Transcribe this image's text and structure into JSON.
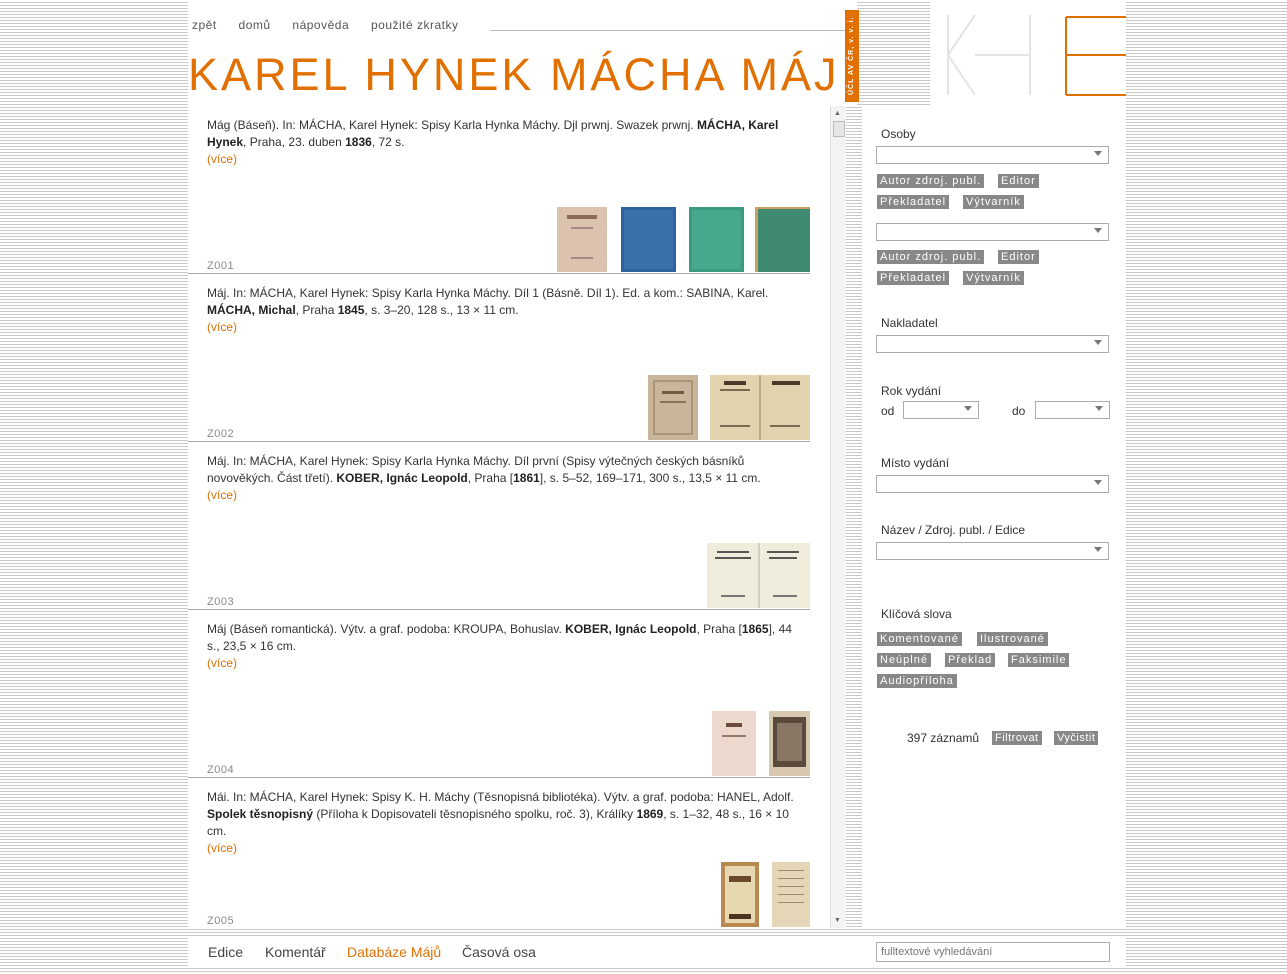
{
  "nav": {
    "items": [
      "zpět",
      "domů",
      "nápověda",
      "použité zkratky"
    ]
  },
  "header": {
    "title": "KAREL HYNEK MÁCHA   MÁJ",
    "badge": "ÚČL AV ČR, v. v. i."
  },
  "logo": {
    "letters": "KHE"
  },
  "records": [
    {
      "pre": "Mág (Báseň). In: MÁCHA, Karel Hynek: Spisy Karla Hynka Máchy. Djl prwnj. Swazek prwnj. ",
      "bold1": "MÁCHA, Karel Hynek",
      "mid1": ", Praha, 23. duben ",
      "year": "1836",
      "post": ", 72 s.",
      "more": "(více)",
      "code": "Z001"
    },
    {
      "pre": "Máj. In: MÁCHA, Karel Hynek: Spisy Karla Hynka Máchy. Díl 1 (Básně. Díl 1). Ed. a kom.: SABINA, Karel. ",
      "bold1": "MÁCHA, Michal",
      "mid1": ", Praha ",
      "year": "1845",
      "post": ", s. 3–20, 128 s., 13 × 11 cm.",
      "more": "(více)",
      "code": "Z002"
    },
    {
      "pre": "Máj. In: MÁCHA, Karel Hynek: Spisy Karla Hynka Máchy. Díl první (Spisy výtečných českých básníků novověkých. Část třetí). ",
      "bold1": "KOBER, Ignác Leopold",
      "mid1": ", Praha [",
      "year": "1861",
      "post": "], s. 5–52, 169–171, 300 s., 13,5 × 11 cm.",
      "more": "(více)",
      "code": "Z003"
    },
    {
      "pre": "Máj (Báseň romantická). Výtv. a graf. podoba: KROUPA, Bohuslav. ",
      "bold1": "KOBER, Ignác Leopold",
      "mid1": ", Praha [",
      "year": "1865",
      "post": "], 44 s., 23,5 × 16 cm.",
      "more": "(více)",
      "code": "Z004"
    },
    {
      "pre": "Mái. In: MÁCHA, Karel Hynek: Spisy K. H. Máchy (Těsnopisná bibliotéka). Výtv. a graf. podoba: HANEL, Adolf. ",
      "bold1": "Spolek těsnopisný",
      "mid1": " (Příloha k Dopisovateli těsnopisného spolku, roč. 3), Králíky ",
      "year": "1869",
      "post": ", s. 1–32, 48 s., 16 × 10 cm.",
      "more": "(více)",
      "code": "Z005"
    }
  ],
  "filters": {
    "persons_label": "Osoby",
    "role_tags": [
      "Autor zdroj. publ.",
      "Editor",
      "Překladatel",
      "Výtvarník"
    ],
    "publisher_label": "Nakladatel",
    "year_label": "Rok vydání",
    "from_label": "od",
    "to_label": "do",
    "place_label": "Místo vydání",
    "title_label": "Název / Zdroj. publ. / Edice",
    "keywords_label": "Klíčová slova",
    "keyword_tags": [
      "Komentované",
      "Ilustrované",
      "Neúplné",
      "Překlad",
      "Faksimile",
      "Audiopříloha"
    ],
    "count": "397 záznamů",
    "filter_button": "Filtrovat",
    "clear_button": "Vyčistit"
  },
  "footer": {
    "links": [
      "Edice",
      "Komentář",
      "Databáze Májů",
      "Časová osa"
    ],
    "search_placeholder": "fulltextové vyhledávání"
  },
  "colors": {
    "accent": "#e17000",
    "tag": "#888888"
  }
}
